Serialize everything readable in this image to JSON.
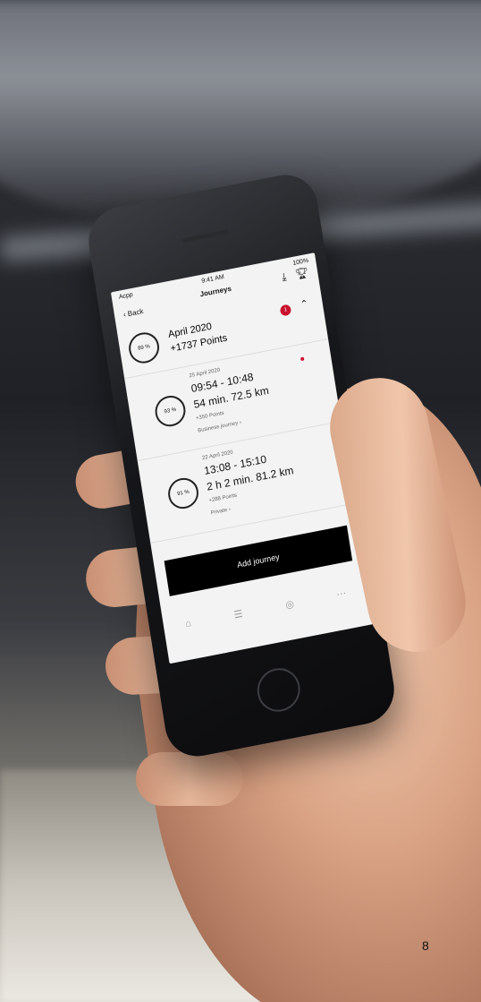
{
  "page_number": "8",
  "phone": {
    "status": {
      "carrier": "Acpp",
      "time": "9:41 AM",
      "battery": "100%"
    },
    "nav": {
      "back": "Back",
      "title": "Journeys",
      "download_icon": "download-icon",
      "trophy_icon": "trophy-icon"
    },
    "month": {
      "percent": "89 %",
      "title": "April 2020",
      "points": "+1737 Points",
      "badge": "1"
    },
    "journeys": [
      {
        "percent": "93 %",
        "date": "25 April 2020",
        "time": "09:54 - 10:48",
        "distance": "54 min. 72.5 km",
        "points": "+350 Points",
        "type": "Business journey"
      },
      {
        "percent": "91 %",
        "date": "22 April 2020",
        "time": "13:08 - 15:10",
        "distance": "2 h 2 min. 81.2 km",
        "points": "+288 Points",
        "type": "Private"
      }
    ],
    "add_button": "Add journey",
    "tabs": [
      "home-icon",
      "list-icon",
      "pin-icon",
      "more-icon"
    ]
  }
}
